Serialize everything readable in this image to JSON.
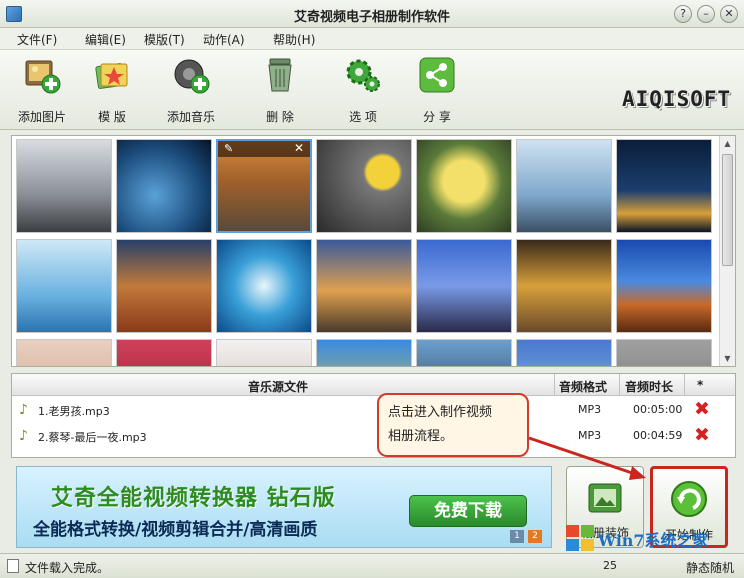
{
  "window": {
    "title": "艾奇视频电子相册制作软件",
    "buttons": [
      "?",
      "–",
      "□",
      "✕"
    ]
  },
  "menu": [
    "文件(F)",
    "编辑(E)",
    "模版(T)",
    "动作(A)",
    "帮助(H)"
  ],
  "toolbar": {
    "items": [
      {
        "label": "添加图片",
        "icon": "add-image-icon"
      },
      {
        "label": "模 版",
        "icon": "template-icon"
      },
      {
        "label": "添加音乐",
        "icon": "add-music-icon"
      },
      {
        "label": "删 除",
        "icon": "trash-icon"
      },
      {
        "label": "选 项",
        "icon": "gear-icon"
      },
      {
        "label": "分 享",
        "icon": "share-icon"
      }
    ],
    "brand": "AIQISOFT"
  },
  "music_table": {
    "headers": [
      "音乐源文件",
      "音频格式",
      "音频时长",
      "*"
    ],
    "rows": [
      {
        "file": "1.老男孩.mp3",
        "format": "MP3",
        "duration": "00:05:00"
      },
      {
        "file": "2.蔡琴-最后一夜.mp3",
        "format": "MP3",
        "duration": "00:04:59"
      }
    ]
  },
  "tooltip": {
    "line1": "点击进入制作视频",
    "line2": "相册流程。"
  },
  "ad": {
    "headline": "艾奇全能视频转换器 钻石版",
    "subline": "全能格式转换/视频剪辑合并/高清画质",
    "download": "免费下载",
    "pages": [
      "1",
      "2"
    ]
  },
  "actions": {
    "decorate": "相册装饰",
    "start": "开始制作"
  },
  "status": {
    "message": "文件载入完成。",
    "rate": "25",
    "mode": "静态随机"
  },
  "watermark": "Win7系统之家",
  "colors": {
    "accent_red": "#c9261e",
    "selection_blue": "#5aa0e0",
    "ad_green": "#2c8c1f"
  }
}
